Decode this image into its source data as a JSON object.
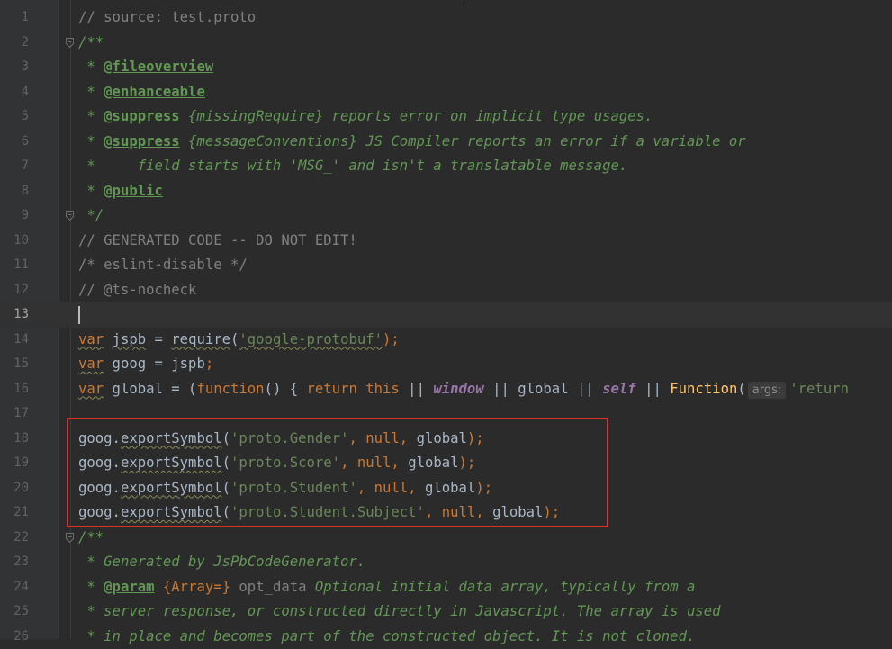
{
  "editor": {
    "lines": [
      {
        "num": "1",
        "fold": false,
        "tokens": [
          {
            "t": "// source: test.proto",
            "c": "cmt"
          }
        ]
      },
      {
        "num": "2",
        "fold": true,
        "tokens": [
          {
            "t": "/**",
            "c": "doc"
          }
        ]
      },
      {
        "num": "3",
        "fold": false,
        "tokens": [
          {
            "t": " * ",
            "c": "doc"
          },
          {
            "t": "@fileoverview",
            "c": "tag"
          }
        ]
      },
      {
        "num": "4",
        "fold": false,
        "tokens": [
          {
            "t": " * ",
            "c": "doc"
          },
          {
            "t": "@enhanceable",
            "c": "tag"
          }
        ]
      },
      {
        "num": "5",
        "fold": false,
        "tokens": [
          {
            "t": " * ",
            "c": "doc"
          },
          {
            "t": "@suppress",
            "c": "tag"
          },
          {
            "t": " {missingRequire} reports error on implicit type usages.",
            "c": "doc"
          }
        ]
      },
      {
        "num": "6",
        "fold": false,
        "tokens": [
          {
            "t": " * ",
            "c": "doc"
          },
          {
            "t": "@suppress",
            "c": "tag"
          },
          {
            "t": " {messageConventions} JS Compiler reports an error if a variable or",
            "c": "doc"
          }
        ]
      },
      {
        "num": "7",
        "fold": false,
        "tokens": [
          {
            "t": " *     field starts with 'MSG_' and isn't a translatable message.",
            "c": "doc"
          }
        ]
      },
      {
        "num": "8",
        "fold": false,
        "tokens": [
          {
            "t": " * ",
            "c": "doc"
          },
          {
            "t": "@public",
            "c": "tag"
          }
        ]
      },
      {
        "num": "9",
        "fold": true,
        "tokens": [
          {
            "t": " */",
            "c": "doc"
          }
        ]
      },
      {
        "num": "10",
        "fold": false,
        "tokens": [
          {
            "t": "// GENERATED CODE -- DO NOT EDIT!",
            "c": "cmt"
          }
        ]
      },
      {
        "num": "11",
        "fold": false,
        "tokens": [
          {
            "t": "/* eslint-disable */",
            "c": "cmt"
          }
        ]
      },
      {
        "num": "12",
        "fold": false,
        "tokens": [
          {
            "t": "// @ts-nocheck",
            "c": "cmt"
          }
        ]
      },
      {
        "num": "13",
        "fold": false,
        "current": true,
        "tokens": []
      },
      {
        "num": "14",
        "fold": false,
        "tokens": [
          {
            "t": "var",
            "c": "kw warn"
          },
          {
            "t": " "
          },
          {
            "t": "jspb",
            "c": "warn"
          },
          {
            "t": " = "
          },
          {
            "t": "require",
            "c": "warn"
          },
          {
            "t": "("
          },
          {
            "t": "'google-protobuf'",
            "c": "str warn"
          },
          {
            "t": ");",
            "c": "kw"
          }
        ]
      },
      {
        "num": "15",
        "fold": false,
        "tokens": [
          {
            "t": "var",
            "c": "kw warn"
          },
          {
            "t": " goog = jspb"
          },
          {
            "t": ";",
            "c": "kw"
          }
        ]
      },
      {
        "num": "16",
        "fold": false,
        "tokens": [
          {
            "t": "var",
            "c": "kw warn"
          },
          {
            "t": " global = ("
          },
          {
            "t": "function",
            "c": "kw"
          },
          {
            "t": "() { "
          },
          {
            "t": "return this",
            "c": "kw"
          },
          {
            "t": " || "
          },
          {
            "t": "window",
            "c": "ital"
          },
          {
            "t": " || global || "
          },
          {
            "t": "self",
            "c": "ital"
          },
          {
            "t": " || "
          },
          {
            "t": "Function",
            "c": "fn"
          },
          {
            "t": "("
          },
          {
            "t": "args:",
            "c": "hint"
          },
          {
            "t": "'return",
            "c": "str"
          }
        ]
      },
      {
        "num": "17",
        "fold": false,
        "tokens": []
      },
      {
        "num": "18",
        "fold": false,
        "tokens": [
          {
            "t": "goog."
          },
          {
            "t": "exportSymbol",
            "c": "warn"
          },
          {
            "t": "("
          },
          {
            "t": "'proto.Gender'",
            "c": "str"
          },
          {
            "t": ", ",
            "c": "kw"
          },
          {
            "t": "null",
            "c": "kw"
          },
          {
            "t": ", ",
            "c": "kw"
          },
          {
            "t": "global"
          },
          {
            "t": ");",
            "c": "kw"
          }
        ]
      },
      {
        "num": "19",
        "fold": false,
        "tokens": [
          {
            "t": "goog."
          },
          {
            "t": "exportSymbol",
            "c": "warn"
          },
          {
            "t": "("
          },
          {
            "t": "'proto.Score'",
            "c": "str"
          },
          {
            "t": ", ",
            "c": "kw"
          },
          {
            "t": "null",
            "c": "kw"
          },
          {
            "t": ", ",
            "c": "kw"
          },
          {
            "t": "global"
          },
          {
            "t": ");",
            "c": "kw"
          }
        ]
      },
      {
        "num": "20",
        "fold": false,
        "tokens": [
          {
            "t": "goog."
          },
          {
            "t": "exportSymbol",
            "c": "warn"
          },
          {
            "t": "("
          },
          {
            "t": "'proto.Student'",
            "c": "str"
          },
          {
            "t": ", ",
            "c": "kw"
          },
          {
            "t": "null",
            "c": "kw"
          },
          {
            "t": ", ",
            "c": "kw"
          },
          {
            "t": "global"
          },
          {
            "t": ");",
            "c": "kw"
          }
        ]
      },
      {
        "num": "21",
        "fold": false,
        "tokens": [
          {
            "t": "goog."
          },
          {
            "t": "exportSymbol",
            "c": "warn"
          },
          {
            "t": "("
          },
          {
            "t": "'proto.Student.Subject'",
            "c": "str"
          },
          {
            "t": ", ",
            "c": "kw"
          },
          {
            "t": "null",
            "c": "kw"
          },
          {
            "t": ", ",
            "c": "kw"
          },
          {
            "t": "global"
          },
          {
            "t": ");",
            "c": "kw"
          }
        ]
      },
      {
        "num": "22",
        "fold": true,
        "tokens": [
          {
            "t": "/**",
            "c": "doc"
          }
        ]
      },
      {
        "num": "23",
        "fold": false,
        "tokens": [
          {
            "t": " * Generated by JsPbCodeGenerator.",
            "c": "doc"
          }
        ]
      },
      {
        "num": "24",
        "fold": false,
        "tokens": [
          {
            "t": " * ",
            "c": "doc"
          },
          {
            "t": "@param",
            "c": "tag"
          },
          {
            "t": " "
          },
          {
            "t": "{Array=}",
            "c": "kw"
          },
          {
            "t": " opt_data",
            "c": "cmt"
          },
          {
            "t": " Optional initial data array, typically from a",
            "c": "doc"
          }
        ]
      },
      {
        "num": "25",
        "fold": false,
        "tokens": [
          {
            "t": " * server response, or constructed directly in Javascript. The array is used",
            "c": "doc"
          }
        ]
      },
      {
        "num": "26",
        "fold": false,
        "tokens": [
          {
            "t": " * in place and becomes part of the constructed object. It is not cloned.",
            "c": "doc"
          }
        ]
      }
    ]
  },
  "colors": {
    "background": "#2b2b2b",
    "gutter": "#313335",
    "comment": "#808080",
    "doc_comment": "#629755",
    "keyword": "#cc7832",
    "string": "#6a8759",
    "identifier": "#a9b7c6",
    "highlight_box": "#d93434"
  }
}
